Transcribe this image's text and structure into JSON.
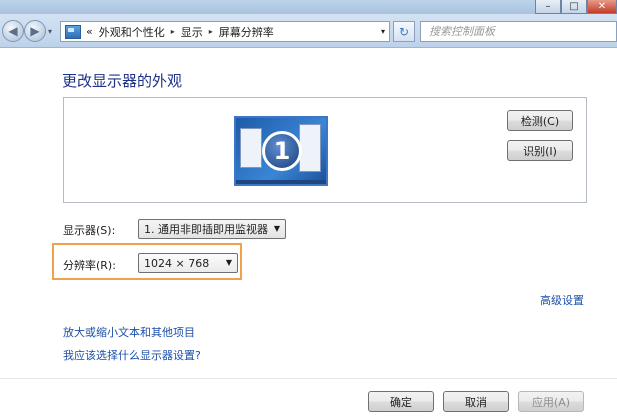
{
  "window": {
    "min_icon": "minimize-icon",
    "max_icon": "maximize-icon",
    "close_icon": "close-icon"
  },
  "nav": {
    "back_icon": "back-arrow-icon",
    "forward_icon": "forward-arrow-icon",
    "prefix": "«",
    "breadcrumbs": [
      "外观和个性化",
      "显示",
      "屏幕分辨率"
    ],
    "separator": "▸",
    "dropdown": "▾",
    "refresh_glyph": "↻",
    "search_placeholder": "搜索控制面板"
  },
  "page": {
    "heading": "更改显示器的外观",
    "monitor_number": "1",
    "detect_button": "检测(C)",
    "identify_button": "识别(I)",
    "display_label": "显示器(S):",
    "display_value": "1. 通用非即插即用监视器",
    "resolution_label": "分辨率(R):",
    "resolution_value": "1024 × 768",
    "advanced_link": "高级设置",
    "text_size_link": "放大或缩小文本和其他项目",
    "which_settings_link": "我应该选择什么显示器设置?"
  },
  "footer": {
    "ok": "确定",
    "cancel": "取消",
    "apply": "应用(A)"
  },
  "colors": {
    "heading": "#1e3287",
    "link": "#1a4fa8",
    "highlight": "#f0a24a"
  }
}
